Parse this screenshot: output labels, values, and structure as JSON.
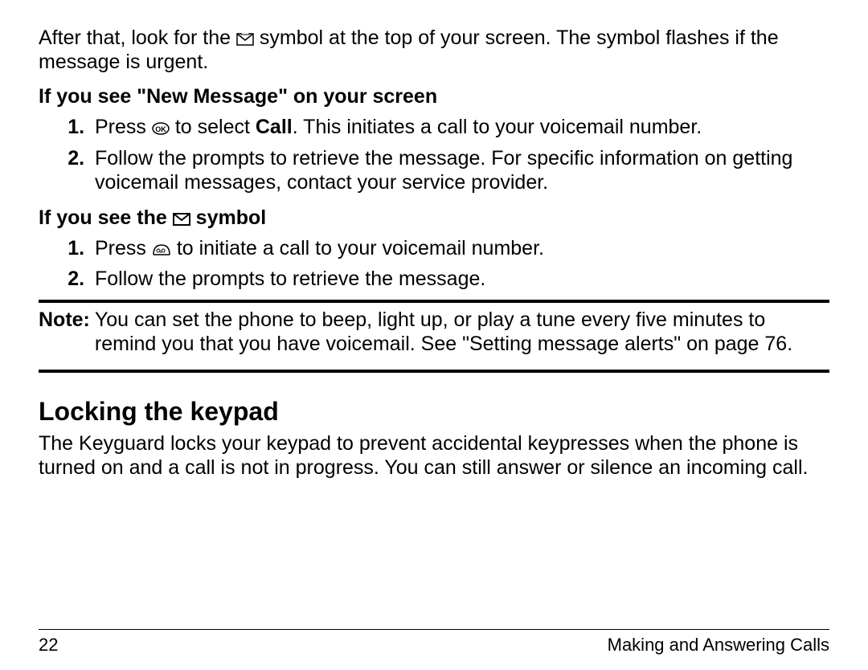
{
  "intro_before_icon": "After that, look for the ",
  "intro_after_icon": " symbol at the top of your screen. The symbol flashes if the message is urgent.",
  "subhead1": "If you see \"New Message\" on your screen",
  "list1": {
    "item1_before": "Press ",
    "item1_mid": " to select ",
    "item1_call": "Call",
    "item1_after": ". This initiates a call to your voicemail number.",
    "item2": "Follow the prompts to retrieve the message. For specific information on getting voicemail messages, contact your service provider."
  },
  "subhead2_before": "If you see the ",
  "subhead2_after": " symbol",
  "list2": {
    "item1_before": "Press ",
    "item1_after": "  to initiate a call to your voicemail number.",
    "item2": "Follow the prompts to retrieve the message."
  },
  "note_label": "Note:",
  "note_body": "You can set the phone to beep, light up, or play a tune every five minutes to remind you that you have voicemail. See \"Setting message alerts\" on page 76.",
  "section_head": "Locking the keypad",
  "keyguard_para": "The Keyguard locks your keypad to prevent accidental keypresses when the phone is turned on and a call is not in progress. You can still answer or silence an incoming call.",
  "page_number": "22",
  "running_title": "Making and Answering Calls"
}
